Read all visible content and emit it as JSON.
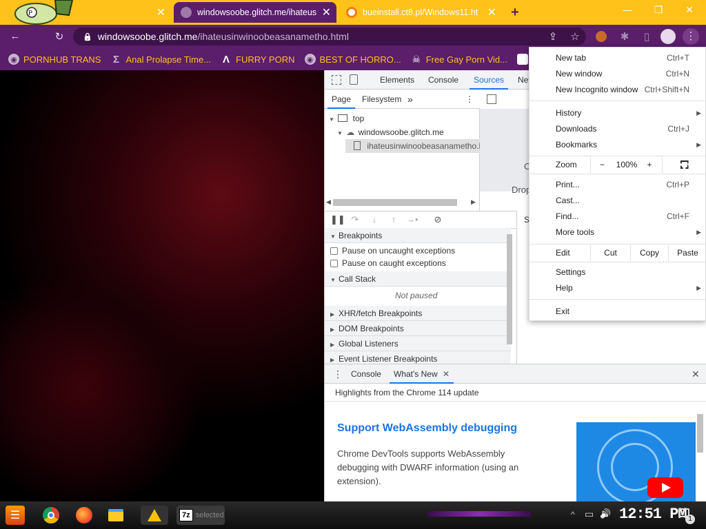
{
  "tabs": [
    {
      "title": "",
      "fav_color": "#8bc34a"
    },
    {
      "title": "windowsoobe.glitch.me/ihateus",
      "fav_color": "#9e7aa8"
    },
    {
      "title": "bueinstall.ct8.pl/Windows11.ht",
      "fav_color": "#f57c00"
    }
  ],
  "tab_close": "✕",
  "new_tab": "+",
  "window_controls": {
    "minimize": "—",
    "restore": "❐",
    "close": "✕"
  },
  "toolbar": {
    "back": "←",
    "reload": "↻",
    "url_host": "windowsoobe.glitch.me",
    "url_path": "/ihateusinwinoobeasanametho.html",
    "lock": "🔒",
    "share": "⇪",
    "star": "☆",
    "extensions": "✱",
    "sidepanel": "▯",
    "profile": "●",
    "menu": "⋮"
  },
  "bookmarks": [
    {
      "label": "PORNHUB TRANS",
      "icon": "globe-icon",
      "glyph": "◉"
    },
    {
      "label": "Anal Prolapse Time...",
      "icon": "bracket-icon",
      "glyph": "Σ"
    },
    {
      "label": "FURRY PORN",
      "icon": "lambda-icon",
      "glyph": "Λ"
    },
    {
      "label": "BEST OF HORRO...",
      "icon": "globe-icon",
      "glyph": "◉"
    },
    {
      "label": "Free Gay Porn Vid...",
      "icon": "skull-icon",
      "glyph": "☠"
    },
    {
      "label": "W",
      "icon": "wr-icon",
      "glyph": "W"
    }
  ],
  "devtools": {
    "tabs": [
      "Elements",
      "Console",
      "Sources",
      "Net"
    ],
    "selected_tab": "Sources",
    "nav_tabs": [
      "Page",
      "Filesystem"
    ],
    "nav_more": "»",
    "tree": [
      {
        "label": "top",
        "indent": 0
      },
      {
        "label": "windowsoobe.glitch.me",
        "indent": 1
      },
      {
        "label": "ihateusinwinoobeasanametho.h",
        "indent": 2
      }
    ],
    "editor_labels": [
      "C",
      "Drop"
    ],
    "sections": [
      {
        "label": "Breakpoints"
      },
      {
        "label": "Call Stack"
      },
      {
        "label": "XHR/fetch Breakpoints"
      },
      {
        "label": "DOM Breakpoints"
      },
      {
        "label": "Global Listeners"
      },
      {
        "label": "Event Listener Breakpoints"
      }
    ],
    "checkboxes": [
      "Pause on uncaught exceptions",
      "Pause on caught exceptions"
    ],
    "not_paused": "Not paused",
    "right_label": "Sc",
    "drawer": {
      "tabs": [
        "Console",
        "What's New"
      ],
      "tab_close": "✕",
      "drawer_close": "✕",
      "drawer_menu": "⋮",
      "highlights": "Highlights from the Chrome 114 update",
      "title": "Support WebAssembly debugging",
      "body": "Chrome DevTools supports WebAssembly debugging with DWARF information (using an extension)."
    }
  },
  "menu": {
    "items_top": [
      {
        "label": "New tab",
        "shortcut": "Ctrl+T"
      },
      {
        "label": "New window",
        "shortcut": "Ctrl+N"
      },
      {
        "label": "New Incognito window",
        "shortcut": "Ctrl+Shift+N"
      }
    ],
    "items_mid": [
      {
        "label": "History",
        "shortcut": "",
        "submenu": true
      },
      {
        "label": "Downloads",
        "shortcut": "Ctrl+J",
        "submenu": false
      },
      {
        "label": "Bookmarks",
        "shortcut": "",
        "submenu": true
      }
    ],
    "zoom_label": "Zoom",
    "zoom_minus": "−",
    "zoom_value": "100%",
    "zoom_plus": "+",
    "fullscreen": "⛶",
    "items_tools": [
      {
        "label": "Print...",
        "shortcut": "Ctrl+P",
        "submenu": false
      },
      {
        "label": "Cast...",
        "shortcut": "",
        "submenu": false
      },
      {
        "label": "Find...",
        "shortcut": "Ctrl+F",
        "submenu": false
      },
      {
        "label": "More tools",
        "shortcut": "",
        "submenu": true
      }
    ],
    "edit_label": "Edit",
    "edit_cut": "Cut",
    "edit_copy": "Copy",
    "edit_paste": "Paste",
    "items_bottom": [
      {
        "label": "Settings",
        "submenu": false
      },
      {
        "label": "Help",
        "submenu": true
      }
    ],
    "exit": "Exit"
  },
  "taskbar": {
    "status_text": "selected",
    "clock": "12:51 PM",
    "notification_count": "1",
    "apps": [
      "start",
      "chrome",
      "firefox",
      "explorer",
      "warning",
      "7z"
    ],
    "app_7z_label": "7z",
    "tray_up": "^",
    "tray_network": "▭",
    "tray_volume": "🔊"
  },
  "colors": {
    "tab_strip": "#ffc21a",
    "toolbar": "#5a1e6b",
    "bookmark_text": "#ffc21a",
    "accent": "#1a73e8"
  }
}
